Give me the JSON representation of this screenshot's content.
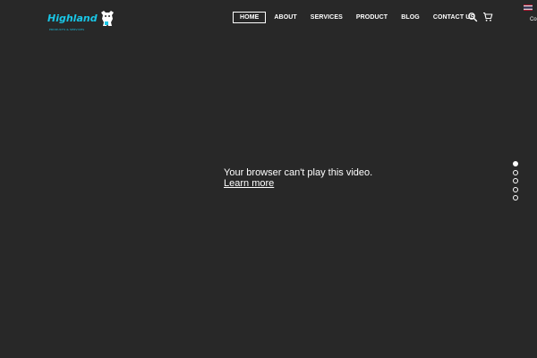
{
  "header": {
    "logo": {
      "name": "Highland",
      "tagline": "PRODUCTS & SERVICES"
    },
    "nav": [
      {
        "label": "HOME",
        "active": true
      },
      {
        "label": "ABOUT",
        "active": false
      },
      {
        "label": "SERVICES",
        "active": false
      },
      {
        "label": "PRODUCT",
        "active": false
      },
      {
        "label": "BLOG",
        "active": false
      },
      {
        "label": "CONTACT US",
        "active": false
      }
    ],
    "icons": {
      "search": "search-icon",
      "cart": "cart-icon"
    },
    "language": {
      "flag": "thai-flag-icon",
      "label": "Co"
    }
  },
  "video": {
    "message": "Your browser can't play this video.",
    "link": "Learn more"
  },
  "slider": {
    "count": 5,
    "active_index": 0
  },
  "colors": {
    "background": "#282828",
    "brand": "#19c6e6",
    "text": "#ffffff"
  }
}
